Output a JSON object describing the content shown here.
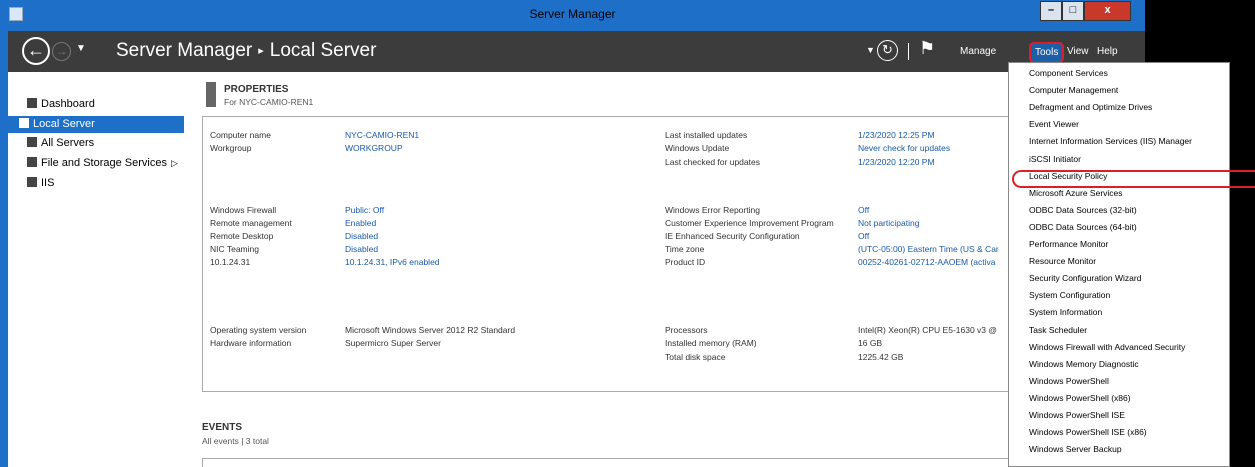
{
  "window": {
    "title": "Server Manager",
    "minimize": "–",
    "maximize": "□",
    "close": "x"
  },
  "header": {
    "breadcrumb": {
      "app": "Server Manager",
      "separator": "▸",
      "page": "Local Server"
    },
    "menus": {
      "manage": "Manage",
      "tools": "Tools",
      "view": "View",
      "help": "Help"
    }
  },
  "sidebar": {
    "items": [
      {
        "label": "Dashboard",
        "icon": "dashboard-icon"
      },
      {
        "label": "Local Server",
        "icon": "server-icon",
        "active": true
      },
      {
        "label": "All Servers",
        "icon": "servers-icon"
      },
      {
        "label": "File and Storage Services",
        "icon": "storage-icon",
        "arrow": "▷"
      },
      {
        "label": "IIS",
        "icon": "iis-icon"
      }
    ]
  },
  "properties": {
    "title": "PROPERTIES",
    "subtitle": "For NYC-CAMIO-REN1",
    "left": [
      {
        "label": "Computer name",
        "value": "NYC-CAMIO-REN1",
        "link": true
      },
      {
        "label": "Workgroup",
        "value": "WORKGROUP",
        "link": true
      },
      {
        "label": "Windows Firewall",
        "value": "Public: Off",
        "link": true
      },
      {
        "label": "Remote management",
        "value": "Enabled",
        "link": true
      },
      {
        "label": "Remote Desktop",
        "value": "Disabled",
        "link": true
      },
      {
        "label": "NIC Teaming",
        "value": "Disabled",
        "link": true
      },
      {
        "label": "10.1.24.31",
        "value": "10.1.24.31, IPv6 enabled",
        "link": true
      },
      {
        "label": "Operating system version",
        "value": "Microsoft Windows Server 2012 R2 Standard",
        "link": false
      },
      {
        "label": "Hardware information",
        "value": "Supermicro Super Server",
        "link": false
      }
    ],
    "right": [
      {
        "label": "Last installed updates",
        "value": "1/23/2020 12:25 PM",
        "link": true
      },
      {
        "label": "Windows Update",
        "value": "Never check for updates",
        "link": true
      },
      {
        "label": "Last checked for updates",
        "value": "1/23/2020 12:20 PM",
        "link": true
      },
      {
        "label": "Windows Error Reporting",
        "value": "Off",
        "link": true
      },
      {
        "label": "Customer Experience Improvement Program",
        "value": "Not participating",
        "link": true
      },
      {
        "label": "IE Enhanced Security Configuration",
        "value": "Off",
        "link": true
      },
      {
        "label": "Time zone",
        "value": "(UTC-05:00) Eastern Time (US & Car",
        "link": true
      },
      {
        "label": "Product ID",
        "value": "00252-40261-02712-AAOEM (activa",
        "link": true
      },
      {
        "label": "Processors",
        "value": "Intel(R) Xeon(R) CPU E5-1630 v3 @",
        "link": false
      },
      {
        "label": "Installed memory (RAM)",
        "value": "16 GB",
        "link": false
      },
      {
        "label": "Total disk space",
        "value": "1225.42 GB",
        "link": false
      }
    ]
  },
  "events": {
    "title": "EVENTS",
    "subtitle": "All events | 3 total"
  },
  "tools_menu": {
    "highlighted": "Local Security Policy",
    "items": [
      "Component Services",
      "Computer Management",
      "Defragment and Optimize Drives",
      "Event Viewer",
      "Internet Information Services (IIS) Manager",
      "iSCSI Initiator",
      "Local Security Policy",
      "Microsoft Azure Services",
      "ODBC Data Sources (32-bit)",
      "ODBC Data Sources (64-bit)",
      "Performance Monitor",
      "Resource Monitor",
      "Security Configuration Wizard",
      "System Configuration",
      "System Information",
      "Task Scheduler",
      "Windows Firewall with Advanced Security",
      "Windows Memory Diagnostic",
      "Windows PowerShell",
      "Windows PowerShell (x86)",
      "Windows PowerShell ISE",
      "Windows PowerShell ISE (x86)",
      "Windows Server Backup"
    ]
  },
  "colors": {
    "accent": "#1e6fc8",
    "header": "#3c3c3c",
    "link": "#1a5aa8",
    "highlight": "#d9202a"
  }
}
